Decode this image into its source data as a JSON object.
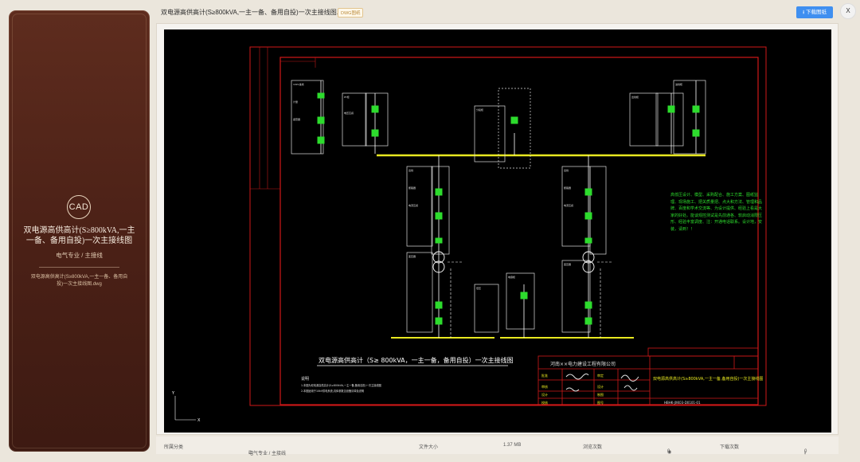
{
  "sidebar": {
    "badge": "CAD",
    "title": "双电源高供高计(S≥800kVA,一主一备、备用自投)一次主接线图",
    "category": "电气专业 / 主接线",
    "filename": "双电源高供高计(S≥800kVA,一主一备、备用自投)一次主接线图.dwg"
  },
  "header": {
    "document_title": "双电源高供高计(S≥800kVA,一主一备、备用自投)一次主接线图.dwg",
    "format_badge": "DWG图纸",
    "download_label": "下载图纸",
    "close_label": "X"
  },
  "drawing": {
    "main_title": "双电源高供高计（S≥ 800kVA，一主一备，备用自投）一次主接线图",
    "company": "河南××电力建设工程有限公司",
    "drawing_name": "双电源高供高计(S≥800kVA,一主一备,备用自投)一次主接线图",
    "drawing_number": "HBHK-JXK03-D0101-01",
    "notes_heading": "说明",
    "green_notes": "高低压设计、模型、采购配合、施工方案、图纸监理、现场施工、把关质量把、点大和方法、管理和品牌、百度和学术交流等、为设计提供、经验上看是大家的好处。能谈观控测试是先前通各、软启动消限压形、经验丰富调度、注：开通电话联系。设计地，安装，请到！！"
  },
  "status": {
    "share_label": "所属分类",
    "category": "电气专业 / 主接线",
    "size_label": "文件大小",
    "size_value": "1.37 MB",
    "views_label": "浏览次数",
    "views_value": "0",
    "downloads_label": "下载次数",
    "downloads_value": "0"
  }
}
